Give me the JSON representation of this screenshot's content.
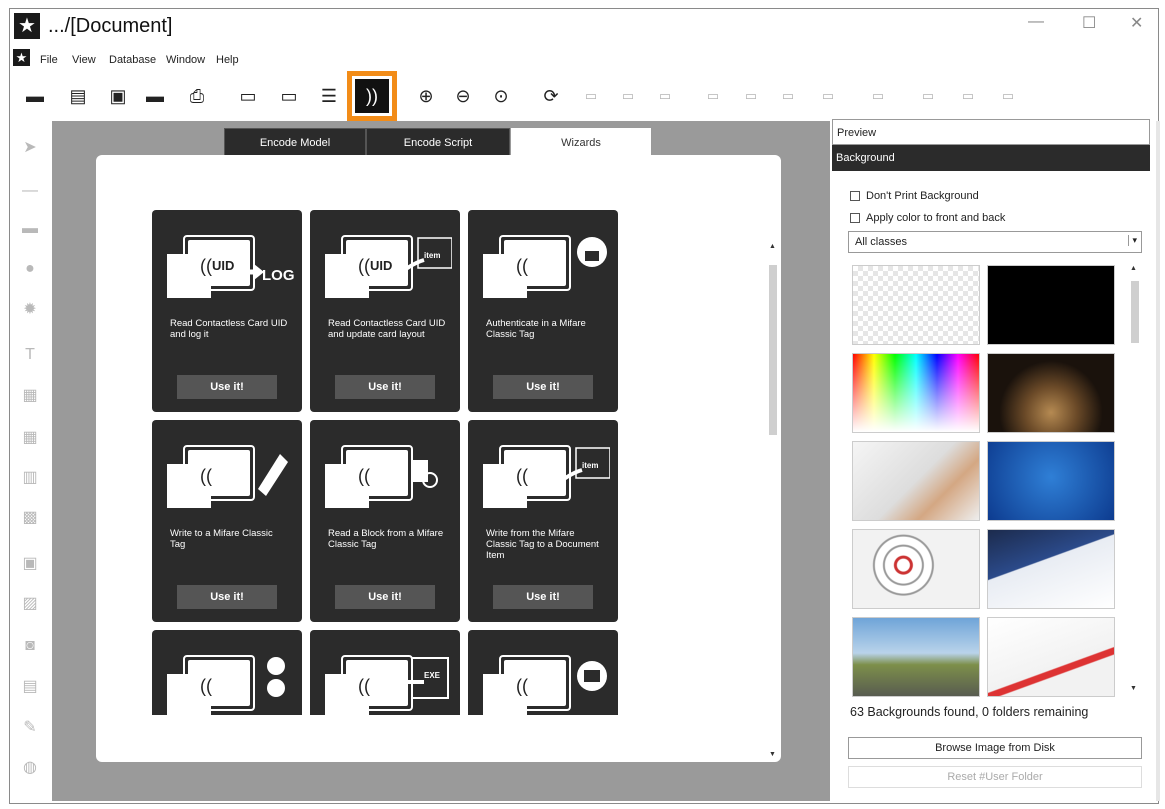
{
  "window": {
    "title": ".../[Document]"
  },
  "menu": [
    "File",
    "View",
    "Database",
    "Window",
    "Help"
  ],
  "tabs": {
    "encode_model": "Encode Model",
    "encode_script": "Encode Script",
    "wizards": "Wizards"
  },
  "wizards": [
    {
      "desc": "Read Contactless Card UID and log it",
      "button": "Use it!",
      "icon": "uid-to-log-icon",
      "icon_text": "UID",
      "icon_text2": "LOG"
    },
    {
      "desc": "Read Contactless Card UID and update card layout",
      "button": "Use it!",
      "icon": "uid-update-layout-icon",
      "icon_text": "UID",
      "icon_text2": "item"
    },
    {
      "desc": "Authenticate in a Mifare Classic Tag",
      "button": "Use it!",
      "icon": "authenticate-lock-icon"
    },
    {
      "desc": "Write to a Mifare Classic Tag",
      "button": "Use it!",
      "icon": "write-pencil-icon"
    },
    {
      "desc": "Read a Block from a Mifare Classic Tag",
      "button": "Use it!",
      "icon": "read-block-icon"
    },
    {
      "desc": "Write from the Mifare Classic Tag to a Document Item",
      "button": "Use it!",
      "icon": "write-to-item-icon",
      "icon_text2": "item"
    },
    {
      "desc": "",
      "button": "",
      "icon": "user-lock-icon"
    },
    {
      "desc": "",
      "button": "",
      "icon": "exe-icon",
      "icon_text2": "EXE"
    },
    {
      "desc": "",
      "button": "",
      "icon": "folder-icon"
    }
  ],
  "right_panel": {
    "preview": "Preview",
    "background": "Background",
    "dont_print": "Don't Print Background",
    "apply_color": "Apply color to front and back",
    "class_select": "All classes",
    "found": "63 Backgrounds found, 0 folders remaining",
    "browse": "Browse Image from Disk",
    "reset": "Reset #User Folder"
  },
  "colors": {
    "highlight": "#f28c18",
    "card": "#2b2b2b",
    "header_dark": "#2b2b2b"
  }
}
